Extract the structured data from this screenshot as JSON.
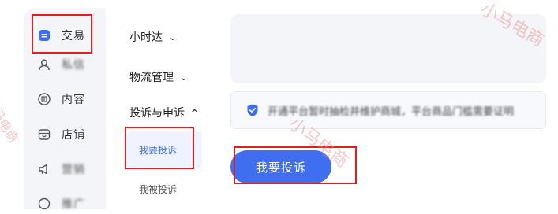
{
  "sidebar": {
    "items": [
      {
        "label": "交易",
        "icon": "trade-icon",
        "blurred": false
      },
      {
        "label": "私信",
        "icon": "user-icon",
        "blurred": true
      },
      {
        "label": "内容",
        "icon": "content-icon",
        "blurred": false
      },
      {
        "label": "店铺",
        "icon": "store-icon",
        "blurred": false
      },
      {
        "label": "营销",
        "icon": "megaphone-icon",
        "blurred": true
      },
      {
        "label": "推广",
        "icon": "promote-icon",
        "blurred": true
      }
    ]
  },
  "submenu": {
    "groups": [
      {
        "label": "小时达",
        "chevron": "⌄"
      },
      {
        "label": "物流管理",
        "chevron": "⌄"
      },
      {
        "label": "投诉与申诉",
        "chevron": "^"
      }
    ],
    "children": [
      {
        "label": "我要投诉",
        "active": true
      },
      {
        "label": "我被投诉",
        "active": false
      }
    ]
  },
  "notice": {
    "text": "开通平台暂时抽检并维护商城，平台商品门槛需要证明"
  },
  "main": {
    "primary_button": "我要投诉"
  },
  "colors": {
    "accent": "#3f6ef0",
    "annotation": "#e02020",
    "watermark": "#f08282"
  },
  "watermark": {
    "text": "小马电商"
  }
}
